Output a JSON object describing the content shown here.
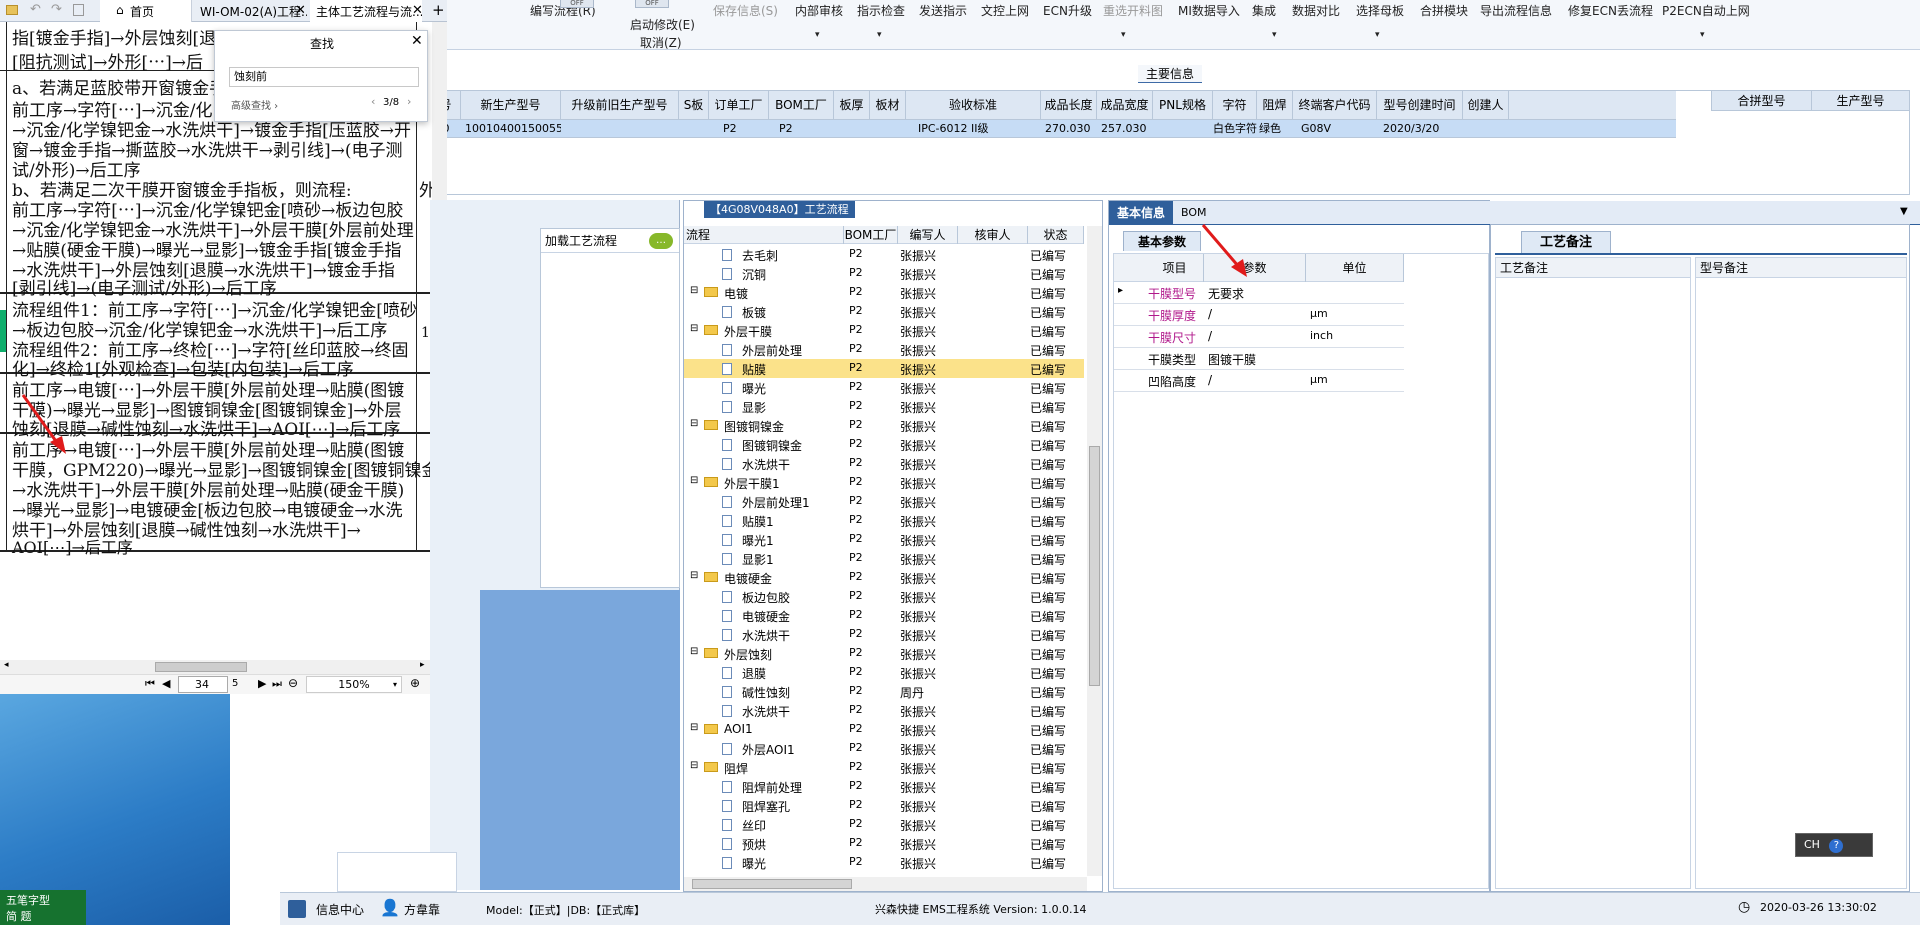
{
  "quick_tabs": [
    "首页",
    "WI-OM-02(A)工程...",
    "主体工艺流程与流...",
    "+"
  ],
  "toolbar": {
    "items": [
      "编写流程(R)",
      "启动修改(E)",
      "保存信息(S)",
      "内部审核",
      "指示检查",
      "发送指示",
      "文控上网",
      "ECN升级",
      "重选开料图",
      "MI数据导入",
      "集成",
      "数据对比",
      "选择母板",
      "合拼模块",
      "导出流程信息",
      "修复ECN丢流程",
      "P2ECN自动上网"
    ],
    "sub_items": [
      "取消(Z)"
    ],
    "partial_labels": [
      "OFF",
      "OFF"
    ]
  },
  "main_info": {
    "title": "主要信息",
    "columns": [
      "号",
      "新生产型号",
      "升级前旧生产型号",
      "S板",
      "订单工厂",
      "BOM工厂",
      "板厚",
      "板材",
      "验收标准",
      "成品长度",
      "成品宽度",
      "PNL规格",
      "字符",
      "阻焊",
      "终端客户代码",
      "型号创建时间",
      "创建人"
    ],
    "row": [
      "A0",
      "10010400150055",
      "",
      "",
      "P2",
      "P2",
      "",
      "",
      "IPC-6012 II级",
      "270.030",
      "257.030",
      "",
      "白色字符",
      "绿色",
      "G08V",
      "2020/3/20",
      ""
    ],
    "right_columns": [
      "合拼型号",
      "生产型号"
    ]
  },
  "find_dialog": {
    "title": "查找",
    "query": "蚀刻前",
    "advanced": "高级查找",
    "result": "3/8"
  },
  "doc": {
    "lines": [
      "指[镀金手指]→外层蚀刻[退",
      "[阻抗测试]→外形[⋯]→后",
      "a、若满足蓝胶带开窗镀金手",
      "前工序→字符[⋯]→沉金/化",
      "→沉金/化学镍钯金→水洗烘干]→镀金手指[压蓝胶→开",
      "窗→镀金手指→撕蓝胶→水洗烘干→剥引线]→(电子测",
      "试/外形)→后工序",
      "b、若满足二次干膜开窗镀金手指板，则流程:",
      "前工序→字符[⋯]→沉金/化学镍钯金[喷砂→板边包胶",
      "→沉金/化学镍钯金→水洗烘干]→外层干膜[外层前处理",
      "→贴膜(硬金干膜)→曝光→显影]→镀金手指[镀金手指",
      "→水洗烘干]→外层蚀刻[退膜→水洗烘干]→镀金手指",
      "[剥引线]→(电子测试/外形)→后工序",
      "流程组件1：前工序→字符[⋯]→沉金/化学镍钯金[喷砂",
      "→板边包胶→沉金/化学镍钯金→水洗烘干]→后工序",
      "流程组件2：前工序→终检[⋯]→字符[丝印蓝胶→终固",
      "化]→终检1[外观检查]→包装[内包装]→后工序",
      "前工序→电镀[⋯]→外层干膜[外层前处理→贴膜(图镀",
      "干膜)→曝光→显影]→图镀铜镍金[图镀铜镍金]→外层",
      "蚀刻[退膜→碱性蚀刻→水洗烘干]→AOI[⋯]→后工序",
      "前工序→电镀[⋯]→外层干膜[外层前处理→贴膜(图镀",
      "干膜，GPM220)→曝光→显影]→图镀铜镍金[图镀铜镍金",
      "→水洗烘干]→外层干膜[外层前处理→贴膜(硬金干膜)",
      "→曝光→显影]→电镀硬金[板边包胶→电镀硬金→水洗",
      "烘干]→外层蚀刻[退膜→碱性蚀刻→水洗烘干]→",
      "AOI[⋯]→后工序"
    ],
    "side_marks": [
      "外",
      "1"
    ],
    "page": "34",
    "total_pages": "5",
    "zoom": "150%"
  },
  "process_panel": {
    "title": "【4G08V048A0】工艺流程",
    "load_button": "加载工艺流程",
    "columns": [
      "流程",
      "BOM工厂",
      "编写人",
      "核审人",
      "状态"
    ],
    "rows": [
      {
        "name": "去毛刺",
        "level": 2,
        "factory": "P2",
        "writer": "张振兴",
        "status": "已编写"
      },
      {
        "name": "沉铜",
        "level": 2,
        "factory": "P2",
        "writer": "张振兴",
        "status": "已编写"
      },
      {
        "name": "电镀",
        "level": 1,
        "factory": "P2",
        "writer": "张振兴",
        "status": "已编写"
      },
      {
        "name": "板镀",
        "level": 2,
        "factory": "P2",
        "writer": "张振兴",
        "status": "已编写"
      },
      {
        "name": "外层干膜",
        "level": 1,
        "factory": "P2",
        "writer": "张振兴",
        "status": "已编写"
      },
      {
        "name": "外层前处理",
        "level": 2,
        "factory": "P2",
        "writer": "张振兴",
        "status": "已编写"
      },
      {
        "name": "贴膜",
        "level": 2,
        "factory": "P2",
        "writer": "张振兴",
        "status": "已编写",
        "selected": true
      },
      {
        "name": "曝光",
        "level": 2,
        "factory": "P2",
        "writer": "张振兴",
        "status": "已编写"
      },
      {
        "name": "显影",
        "level": 2,
        "factory": "P2",
        "writer": "张振兴",
        "status": "已编写"
      },
      {
        "name": "图镀铜镍金",
        "level": 1,
        "factory": "P2",
        "writer": "张振兴",
        "status": "已编写"
      },
      {
        "name": "图镀铜镍金",
        "level": 2,
        "factory": "P2",
        "writer": "张振兴",
        "status": "已编写"
      },
      {
        "name": "水洗烘干",
        "level": 2,
        "factory": "P2",
        "writer": "张振兴",
        "status": "已编写"
      },
      {
        "name": "外层干膜1",
        "level": 1,
        "factory": "P2",
        "writer": "张振兴",
        "status": "已编写"
      },
      {
        "name": "外层前处理1",
        "level": 2,
        "factory": "P2",
        "writer": "张振兴",
        "status": "已编写"
      },
      {
        "name": "贴膜1",
        "level": 2,
        "factory": "P2",
        "writer": "张振兴",
        "status": "已编写"
      },
      {
        "name": "曝光1",
        "level": 2,
        "factory": "P2",
        "writer": "张振兴",
        "status": "已编写"
      },
      {
        "name": "显影1",
        "level": 2,
        "factory": "P2",
        "writer": "张振兴",
        "status": "已编写"
      },
      {
        "name": "电镀硬金",
        "level": 1,
        "factory": "P2",
        "writer": "张振兴",
        "status": "已编写"
      },
      {
        "name": "板边包胶",
        "level": 2,
        "factory": "P2",
        "writer": "张振兴",
        "status": "已编写"
      },
      {
        "name": "电镀硬金",
        "level": 2,
        "factory": "P2",
        "writer": "张振兴",
        "status": "已编写"
      },
      {
        "name": "水洗烘干",
        "level": 2,
        "factory": "P2",
        "writer": "张振兴",
        "status": "已编写"
      },
      {
        "name": "外层蚀刻",
        "level": 1,
        "factory": "P2",
        "writer": "张振兴",
        "status": "已编写"
      },
      {
        "name": "退膜",
        "level": 2,
        "factory": "P2",
        "writer": "张振兴",
        "status": "已编写"
      },
      {
        "name": "碱性蚀刻",
        "level": 2,
        "factory": "P2",
        "writer": "周丹",
        "status": "已编写"
      },
      {
        "name": "水洗烘干",
        "level": 2,
        "factory": "P2",
        "writer": "张振兴",
        "status": "已编写"
      },
      {
        "name": "AOI1",
        "level": 1,
        "factory": "P2",
        "writer": "张振兴",
        "status": "已编写"
      },
      {
        "name": "外层AOI1",
        "level": 2,
        "factory": "P2",
        "writer": "张振兴",
        "status": "已编写"
      },
      {
        "name": "阻焊",
        "level": 1,
        "factory": "P2",
        "writer": "张振兴",
        "status": "已编写"
      },
      {
        "name": "阻焊前处理",
        "level": 2,
        "factory": "P2",
        "writer": "张振兴",
        "status": "已编写"
      },
      {
        "name": "阻焊塞孔",
        "level": 2,
        "factory": "P2",
        "writer": "张振兴",
        "status": "已编写"
      },
      {
        "name": "丝印",
        "level": 2,
        "factory": "P2",
        "writer": "张振兴",
        "status": "已编写"
      },
      {
        "name": "预烘",
        "level": 2,
        "factory": "P2",
        "writer": "张振兴",
        "status": "已编写"
      },
      {
        "name": "曝光",
        "level": 2,
        "factory": "P2",
        "writer": "张振兴",
        "status": "已编写"
      }
    ]
  },
  "basic_info": {
    "tabs": [
      "基本信息",
      "BOM"
    ],
    "subtab": "基本参数",
    "columns": [
      "项目",
      "参数",
      "单位"
    ],
    "rows": [
      {
        "item": "干膜型号",
        "value": "无要求",
        "unit": "",
        "highlight": true
      },
      {
        "item": "干膜厚度",
        "value": "/",
        "unit": "μm",
        "highlight": true
      },
      {
        "item": "干膜尺寸",
        "value": "/",
        "unit": "inch",
        "highlight": true
      },
      {
        "item": "干膜类型",
        "value": "图镀干膜",
        "unit": "",
        "highlight": false
      },
      {
        "item": "凹陷高度",
        "value": "/",
        "unit": "μm",
        "highlight": false
      }
    ]
  },
  "notes_panel": {
    "tab": "工艺备注",
    "left_header": "工艺备注",
    "right_header": "型号备注"
  },
  "status_bar": {
    "info_center": "信息中心",
    "user": "方韋靠",
    "model": "Model:【正式】|DB:【正式库】",
    "app": "兴森快捷 EMS工程系统 Version: 1.0.0.14",
    "datetime": "2020-03-26 13:30:02"
  },
  "desktop": {
    "ime_lines": [
      "五笔字型",
      "简 题"
    ],
    "ime_box": "CH"
  },
  "colors": {
    "accent_blue": "#2d66b3",
    "header_bg": "#d7e4f3",
    "selected_row": "#c6dcf5",
    "tree_selected": "#fbe28a",
    "highlight_text": "#b0188b",
    "arrow_red": "#e01b1b"
  }
}
